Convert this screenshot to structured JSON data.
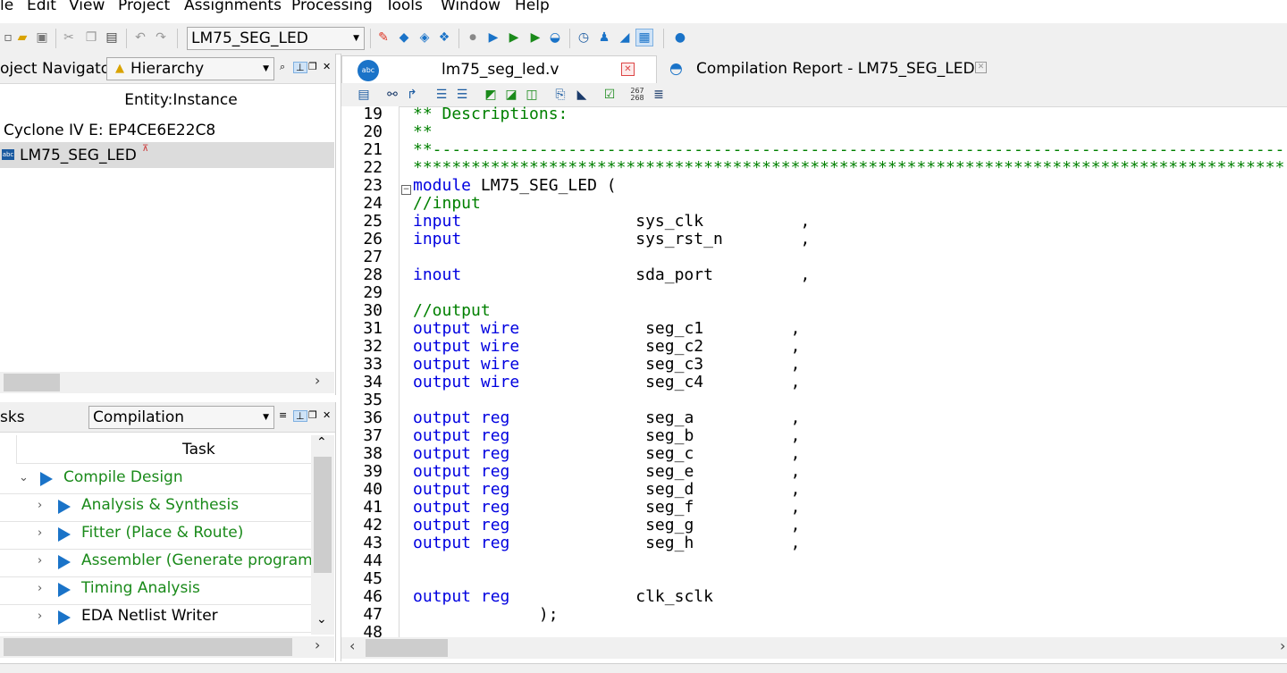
{
  "menu": [
    "le",
    "Edit",
    "View",
    "Project",
    "Assignments",
    "Processing",
    "Tools",
    "Window",
    "Help"
  ],
  "toolbar": {
    "entity_combo": "LM75_SEG_LED"
  },
  "navigator": {
    "title": "oject Navigator",
    "view_combo": "Hierarchy",
    "column_header": "Entity:Instance",
    "device": "Cyclone IV E: EP4CE6E22C8",
    "top_entity": "LM75_SEG_LED"
  },
  "tasks": {
    "title": "sks",
    "flow_combo": "Compilation",
    "column_header": "Task",
    "items": [
      {
        "label": "Compile Design"
      },
      {
        "label": "Analysis & Synthesis"
      },
      {
        "label": "Fitter (Place & Route)"
      },
      {
        "label": "Assembler (Generate programm"
      },
      {
        "label": "Timing Analysis"
      },
      {
        "label": "EDA Netlist Writer"
      }
    ]
  },
  "editor": {
    "tabs": [
      {
        "label": "lm75_seg_led.v"
      },
      {
        "label": "Compilation Report - LM75_SEG_LED"
      }
    ],
    "lines": [
      {
        "n": "19",
        "parts": [
          [
            "cm",
            "** Descriptions:"
          ]
        ]
      },
      {
        "n": "20",
        "parts": [
          [
            "cm",
            "**"
          ]
        ]
      },
      {
        "n": "21",
        "parts": [
          [
            "cm",
            "**----------------------------------------------------------------------------------------"
          ]
        ]
      },
      {
        "n": "22",
        "parts": [
          [
            "cm",
            "******************************************************************************************"
          ]
        ]
      },
      {
        "n": "23",
        "parts": [
          [
            "kw",
            "module"
          ],
          [
            "tx",
            " LM75_SEG_LED ("
          ]
        ]
      },
      {
        "n": "24",
        "parts": [
          [
            "cm",
            "//input"
          ]
        ]
      },
      {
        "n": "25",
        "parts": [
          [
            "kw",
            "input"
          ],
          [
            "tx",
            "                  sys_clk          ,"
          ]
        ]
      },
      {
        "n": "26",
        "parts": [
          [
            "kw",
            "input"
          ],
          [
            "tx",
            "                  sys_rst_n        ,"
          ]
        ]
      },
      {
        "n": "27",
        "parts": []
      },
      {
        "n": "28",
        "parts": [
          [
            "kw",
            "inout"
          ],
          [
            "tx",
            "                  sda_port         ,"
          ]
        ]
      },
      {
        "n": "29",
        "parts": []
      },
      {
        "n": "30",
        "parts": [
          [
            "cm",
            "//output"
          ]
        ]
      },
      {
        "n": "31",
        "parts": [
          [
            "kw",
            "output wire"
          ],
          [
            "tx",
            "             seg_c1         ,"
          ]
        ]
      },
      {
        "n": "32",
        "parts": [
          [
            "kw",
            "output wire"
          ],
          [
            "tx",
            "             seg_c2         ,"
          ]
        ]
      },
      {
        "n": "33",
        "parts": [
          [
            "kw",
            "output wire"
          ],
          [
            "tx",
            "             seg_c3         ,"
          ]
        ]
      },
      {
        "n": "34",
        "parts": [
          [
            "kw",
            "output wire"
          ],
          [
            "tx",
            "             seg_c4         ,"
          ]
        ]
      },
      {
        "n": "35",
        "parts": []
      },
      {
        "n": "36",
        "parts": [
          [
            "kw",
            "output reg"
          ],
          [
            "tx",
            "              seg_a          ,"
          ]
        ]
      },
      {
        "n": "37",
        "parts": [
          [
            "kw",
            "output reg"
          ],
          [
            "tx",
            "              seg_b          ,"
          ]
        ]
      },
      {
        "n": "38",
        "parts": [
          [
            "kw",
            "output reg"
          ],
          [
            "tx",
            "              seg_c          ,"
          ]
        ]
      },
      {
        "n": "39",
        "parts": [
          [
            "kw",
            "output reg"
          ],
          [
            "tx",
            "              seg_e          ,"
          ]
        ]
      },
      {
        "n": "40",
        "parts": [
          [
            "kw",
            "output reg"
          ],
          [
            "tx",
            "              seg_d          ,"
          ]
        ]
      },
      {
        "n": "41",
        "parts": [
          [
            "kw",
            "output reg"
          ],
          [
            "tx",
            "              seg_f          ,"
          ]
        ]
      },
      {
        "n": "42",
        "parts": [
          [
            "kw",
            "output reg"
          ],
          [
            "tx",
            "              seg_g          ,"
          ]
        ]
      },
      {
        "n": "43",
        "parts": [
          [
            "kw",
            "output reg"
          ],
          [
            "tx",
            "              seg_h          ,"
          ]
        ]
      },
      {
        "n": "44",
        "parts": []
      },
      {
        "n": "45",
        "parts": []
      },
      {
        "n": "46",
        "parts": [
          [
            "kw",
            "output reg"
          ],
          [
            "tx",
            "             clk_sclk"
          ]
        ]
      },
      {
        "n": "47",
        "parts": [
          [
            "tx",
            "             );"
          ]
        ]
      },
      {
        "n": "48",
        "parts": []
      }
    ]
  }
}
